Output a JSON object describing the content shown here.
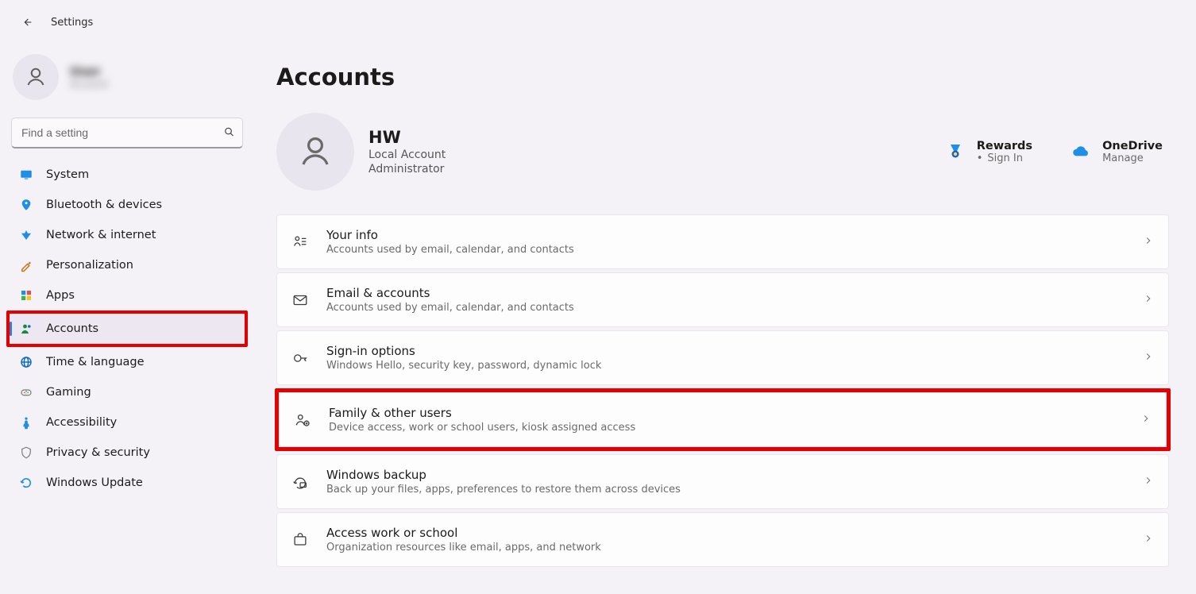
{
  "titlebar": {
    "app_title": "Settings"
  },
  "sidebar": {
    "profile": {
      "name": "User",
      "sub": "Account"
    },
    "search_placeholder": "Find a setting",
    "items": [
      {
        "label": "System"
      },
      {
        "label": "Bluetooth & devices"
      },
      {
        "label": "Network & internet"
      },
      {
        "label": "Personalization"
      },
      {
        "label": "Apps"
      },
      {
        "label": "Accounts"
      },
      {
        "label": "Time & language"
      },
      {
        "label": "Gaming"
      },
      {
        "label": "Accessibility"
      },
      {
        "label": "Privacy & security"
      },
      {
        "label": "Windows Update"
      }
    ],
    "active_index": 5,
    "highlight_index": 5
  },
  "page": {
    "heading": "Accounts",
    "account": {
      "name": "HW",
      "type": "Local Account",
      "role": "Administrator"
    },
    "quicklinks": {
      "rewards": {
        "title": "Rewards",
        "sub": "Sign In"
      },
      "onedrive": {
        "title": "OneDrive",
        "sub": "Manage"
      }
    },
    "cards": [
      {
        "title": "Your info",
        "sub": "Accounts used by email, calendar, and contacts"
      },
      {
        "title": "Email & accounts",
        "sub": "Accounts used by email, calendar, and contacts"
      },
      {
        "title": "Sign-in options",
        "sub": "Windows Hello, security key, password, dynamic lock"
      },
      {
        "title": "Family & other users",
        "sub": "Device access, work or school users, kiosk assigned access"
      },
      {
        "title": "Windows backup",
        "sub": "Back up your files, apps, preferences to restore them across devices"
      },
      {
        "title": "Access work or school",
        "sub": "Organization resources like email, apps, and network"
      }
    ],
    "highlight_card_index": 3
  }
}
